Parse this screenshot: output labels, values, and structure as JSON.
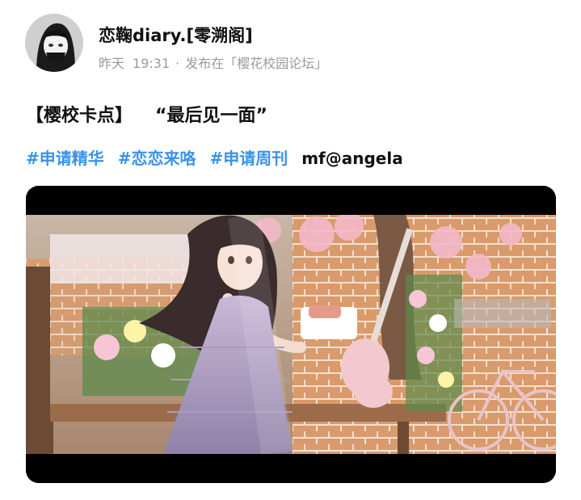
{
  "post": {
    "author": "恋鞠diary.[零溯阁]",
    "time_day": "昨天",
    "time_clock": "19:31",
    "separator": "·",
    "published_in_prefix": "发布在",
    "forum": "「樱花校园论坛」"
  },
  "content": {
    "title_bracket": "【樱校卡点】",
    "title_quote": "“最后见一面”",
    "tags": [
      "#申请精华",
      "#恋恋来咯",
      "#申请周刊"
    ],
    "mention": "mf@angela"
  },
  "colors": {
    "tag": "#3a93e8",
    "text": "#111111",
    "meta": "#9a9a9a",
    "video_bar": "#000000"
  },
  "video": {
    "thumbnail_icon": "anime-girl-with-cake-and-guitar"
  }
}
